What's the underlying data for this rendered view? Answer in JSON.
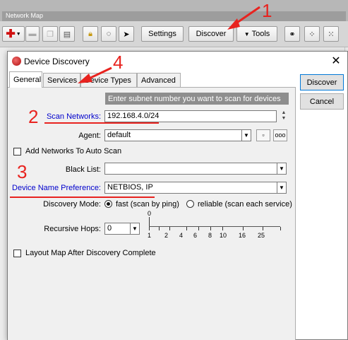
{
  "network_map": {
    "title": "Network Map",
    "toolbar": {
      "settings_label": "Settings",
      "discover_label": "Discover",
      "tools_label": "Tools"
    }
  },
  "dialog": {
    "title": "Device Discovery",
    "tabs": [
      "General",
      "Services",
      "Device Types",
      "Advanced"
    ],
    "active_tab": "General",
    "buttons": {
      "discover": "Discover",
      "cancel": "Cancel"
    },
    "hint": "Enter subnet number you want to scan for devices",
    "scan_networks": {
      "label": "Scan Networks:",
      "value": "192.168.4.0/24"
    },
    "agent": {
      "label": "Agent:",
      "value": "default"
    },
    "add_networks": {
      "label": "Add Networks To Auto Scan",
      "checked": false
    },
    "black_list": {
      "label": "Black List:",
      "value": ""
    },
    "device_name_pref": {
      "label": "Device Name Preference:",
      "value": "NETBIOS, IP"
    },
    "discovery_mode": {
      "label": "Discovery Mode:",
      "options": [
        "fast (scan by ping)",
        "reliable (scan each service)"
      ],
      "selected": "fast (scan by ping)"
    },
    "recursive_hops": {
      "label": "Recursive Hops:",
      "value": "0",
      "slider_value": 0,
      "scale": [
        "0",
        "1",
        "2",
        "4",
        "6",
        "8",
        "10",
        "16",
        "25"
      ]
    },
    "layout_after": {
      "label": "Layout Map After Discovery Complete",
      "checked": false
    },
    "agent_btn_dots": "ooo"
  },
  "annotations": [
    "1",
    "2",
    "3",
    "4"
  ],
  "colors": {
    "annotation": "#e8231f",
    "link_label": "#0000cc",
    "hint_bg": "#8e8e8e"
  }
}
